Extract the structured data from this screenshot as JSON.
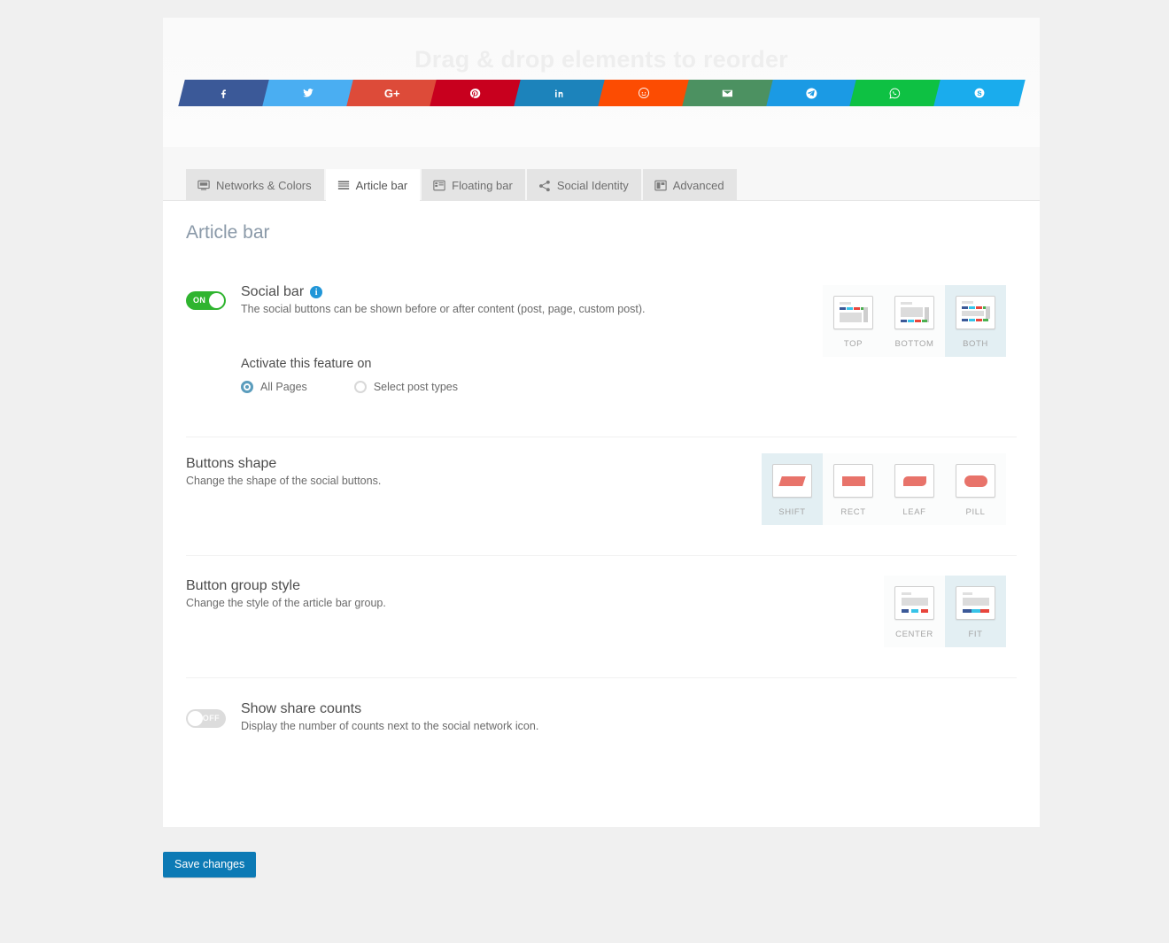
{
  "reorder": {
    "title": "Drag & drop elements to reorder",
    "subtitle": "",
    "buttons": [
      {
        "name": "facebook",
        "icon": "facebook-icon",
        "color": "#3b5998"
      },
      {
        "name": "twitter",
        "icon": "twitter-icon",
        "color": "#4aaef2"
      },
      {
        "name": "google-plus",
        "icon": "google-plus-icon",
        "color": "#dd4b39"
      },
      {
        "name": "pinterest",
        "icon": "pinterest-icon",
        "color": "#c8001e"
      },
      {
        "name": "linkedin",
        "icon": "linkedin-icon",
        "color": "#1c83bb"
      },
      {
        "name": "reddit",
        "icon": "reddit-icon",
        "color": "#fc4c02"
      },
      {
        "name": "email",
        "icon": "envelope-icon",
        "color": "#4c9161"
      },
      {
        "name": "telegram",
        "icon": "telegram-icon",
        "color": "#1b9ae4"
      },
      {
        "name": "whatsapp",
        "icon": "whatsapp-icon",
        "color": "#0ec143"
      },
      {
        "name": "skype",
        "icon": "skype-icon",
        "color": "#1aaced"
      }
    ]
  },
  "tabs": [
    {
      "label": "Networks & Colors",
      "icon": "monitor-icon",
      "active": false
    },
    {
      "label": "Article bar",
      "icon": "article-bar-icon",
      "active": true
    },
    {
      "label": "Floating bar",
      "icon": "floating-bar-icon",
      "active": false
    },
    {
      "label": "Social Identity",
      "icon": "share-icon",
      "active": false
    },
    {
      "label": "Advanced",
      "icon": "advanced-icon",
      "active": false
    }
  ],
  "page_title": "Article bar",
  "social_bar": {
    "toggle_state": "ON",
    "toggle_on": true,
    "title": "Social bar",
    "info_glyph": "i",
    "description": "The social buttons can be shown before or after content (post, page, custom post).",
    "activate_label": "Activate this feature on",
    "radios": [
      {
        "label": "All Pages",
        "selected": true
      },
      {
        "label": "Select post types",
        "selected": false
      }
    ],
    "positions": [
      {
        "label": "TOP",
        "selected": false
      },
      {
        "label": "BOTTOM",
        "selected": false
      },
      {
        "label": "BOTH",
        "selected": true
      }
    ]
  },
  "buttons_shape": {
    "title": "Buttons shape",
    "description": "Change the shape of the social buttons.",
    "options": [
      {
        "label": "SHIFT",
        "selected": true
      },
      {
        "label": "RECT",
        "selected": false
      },
      {
        "label": "LEAF",
        "selected": false
      },
      {
        "label": "PILL",
        "selected": false
      }
    ]
  },
  "button_group_style": {
    "title": "Button group style",
    "description": "Change the style of the article bar group.",
    "options": [
      {
        "label": "CENTER",
        "selected": false
      },
      {
        "label": "FIT",
        "selected": true
      }
    ]
  },
  "share_counts": {
    "toggle_state": "OFF",
    "toggle_on": false,
    "title": "Show share counts",
    "description": "Display the number of counts next to the social network icon."
  },
  "save_label": "Save changes",
  "colors": {
    "accent": "#0c7ab5",
    "selected_option_bg": "#e3eff3",
    "toggle_on": "#2fb42f",
    "shape_fill": "#e8736a"
  }
}
